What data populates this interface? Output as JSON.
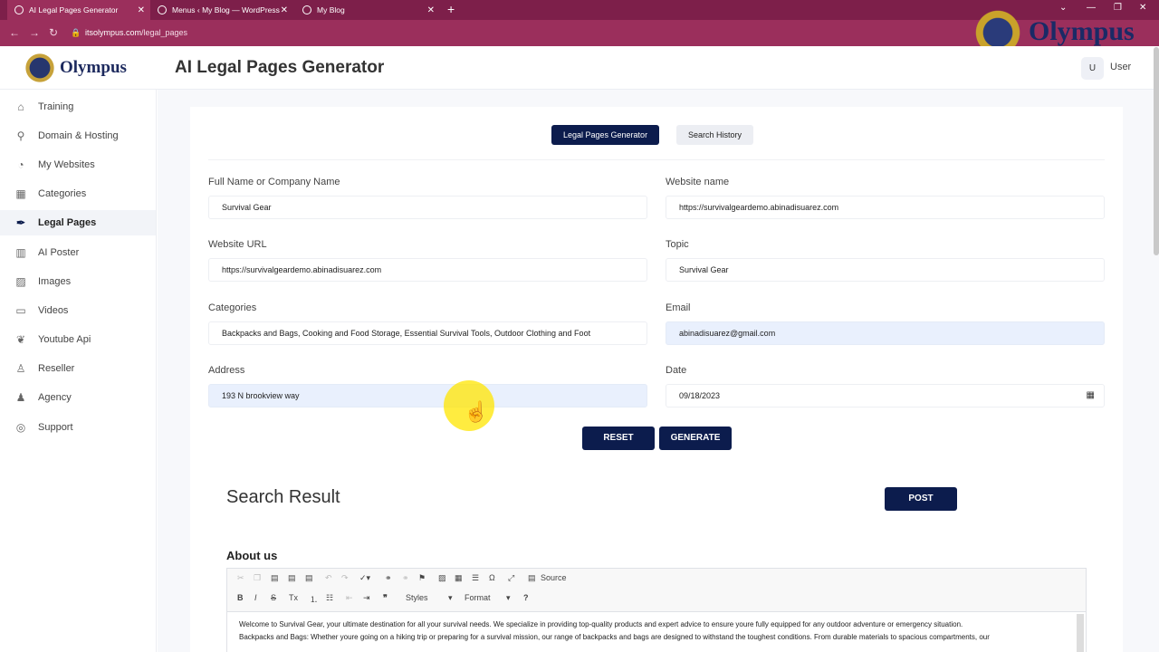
{
  "browser": {
    "tabs": [
      {
        "title": "AI Legal Pages Generator"
      },
      {
        "title": "Menus ‹ My Blog — WordPress"
      },
      {
        "title": "My Blog"
      }
    ],
    "url_host": "itsolympus.com",
    "url_path": "/legal_pages"
  },
  "watermark": {
    "text": "Olympus"
  },
  "header": {
    "logo_text": "Olympus",
    "page_title": "AI Legal Pages Generator",
    "user_initial": "U",
    "user_name": "User"
  },
  "sidebar": {
    "items": [
      {
        "label": "Training",
        "icon": "home-icon"
      },
      {
        "label": "Domain & Hosting",
        "icon": "search-icon"
      },
      {
        "label": "My Websites",
        "icon": "gauge-icon"
      },
      {
        "label": "Categories",
        "icon": "grid-icon"
      },
      {
        "label": "Legal Pages",
        "icon": "feather-icon"
      },
      {
        "label": "AI Poster",
        "icon": "book-icon"
      },
      {
        "label": "Images",
        "icon": "image-icon"
      },
      {
        "label": "Videos",
        "icon": "video-icon"
      },
      {
        "label": "Youtube Api",
        "icon": "leaf-icon"
      },
      {
        "label": "Reseller",
        "icon": "person-icon"
      },
      {
        "label": "Agency",
        "icon": "people-icon"
      },
      {
        "label": "Support",
        "icon": "support-icon"
      }
    ],
    "active_index": 4
  },
  "toggle": {
    "generator_label": "Legal Pages Generator",
    "history_label": "Search History"
  },
  "form": {
    "full_name_label": "Full Name or Company Name",
    "full_name_value": "Survival Gear",
    "website_name_label": "Website name",
    "website_name_value": "https://survivalgeardemo.abinadisuarez.com",
    "website_url_label": "Website URL",
    "website_url_value": "https://survivalgeardemo.abinadisuarez.com",
    "topic_label": "Topic",
    "topic_value": "Survival Gear",
    "categories_label": "Categories",
    "categories_value": "Backpacks and Bags, Cooking and Food Storage, Essential Survival Tools, Outdoor Clothing and Foot",
    "email_label": "Email",
    "email_value": "abinadisuarez@gmail.com",
    "address_label": "Address",
    "address_value": "193 N brookview way",
    "date_label": "Date",
    "date_value": "09/18/2023",
    "reset_label": "RESET",
    "generate_label": "GENERATE"
  },
  "result": {
    "title": "Search Result",
    "post_label": "POST",
    "section_title": "About us",
    "editor": {
      "source_label": "Source",
      "styles_label": "Styles",
      "format_label": "Format",
      "help_label": "?",
      "line1": "Welcome to Survival Gear, your ultimate destination for all your survival needs. We specialize in providing top-quality products and expert advice to ensure youre fully equipped for any outdoor adventure or emergency situation.",
      "line2": "Backpacks and Bags: Whether youre going on a hiking trip or preparing for a survival mission, our range of backpacks and bags are designed to withstand the toughest conditions. From durable materials to spacious compartments, our"
    }
  },
  "colors": {
    "tab_bar": "#7d1f4a",
    "address_bar": "#9b2f5c",
    "primary": "#0c1c4d",
    "filled_input": "#e9f0fd",
    "cursor_highlight": "#ffe600"
  }
}
